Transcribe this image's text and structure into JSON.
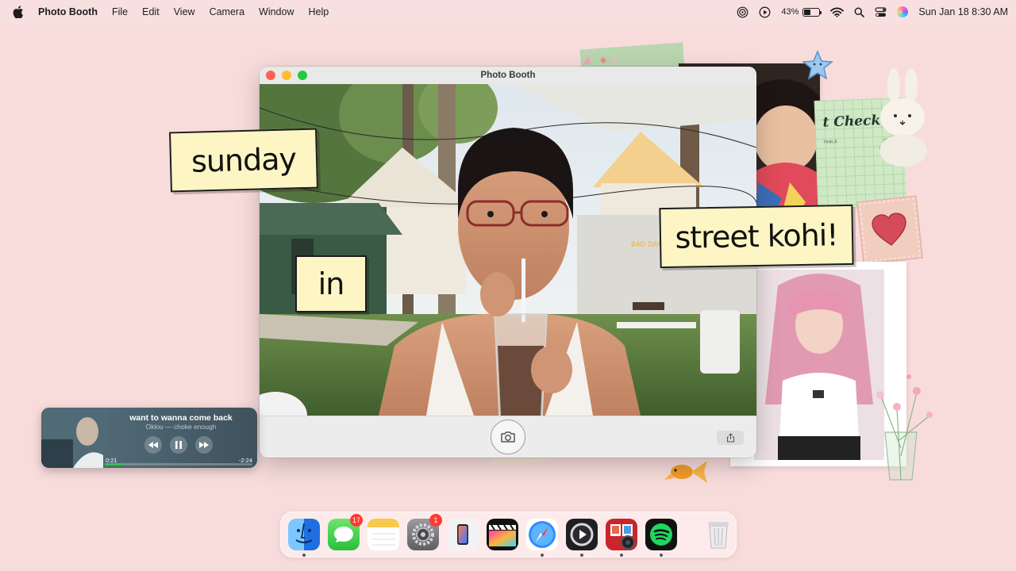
{
  "menubar": {
    "app_name": "Photo Booth",
    "menus": [
      "File",
      "Edit",
      "View",
      "Camera",
      "Window",
      "Help"
    ],
    "battery_percent": "43%",
    "battery_level": 0.43,
    "datetime": "Sun Jan 18  8:30 AM"
  },
  "window": {
    "title": "Photo Booth"
  },
  "notes": {
    "sunday": "sunday",
    "in": "in",
    "street": "street kohi!"
  },
  "decor": {
    "check_title": "t Check",
    "check_col1": "TABLE",
    "check_col2": "CHECK",
    "check_number": "0124",
    "wall_text": "BAD DAY ARE TEMPORA"
  },
  "now_playing": {
    "title": "want to wanna come back",
    "artist": "Oklou — choke enough",
    "elapsed": "0:21",
    "remaining": "-2:24",
    "progress": 0.13
  },
  "dock": {
    "messages_badge": "17",
    "settings_badge": "1",
    "apps": [
      "Finder",
      "Messages",
      "Notes",
      "System Settings",
      "iPhone Mirroring",
      "Final Cut Pro",
      "Safari",
      "QuickTime Player",
      "Photo Booth",
      "Spotify",
      "Trash"
    ]
  },
  "colors": {
    "desktop": "#f8dcdc",
    "sticky_note": "#fdf5c4",
    "progress": "#33c24d",
    "badge": "#ff3b30"
  }
}
